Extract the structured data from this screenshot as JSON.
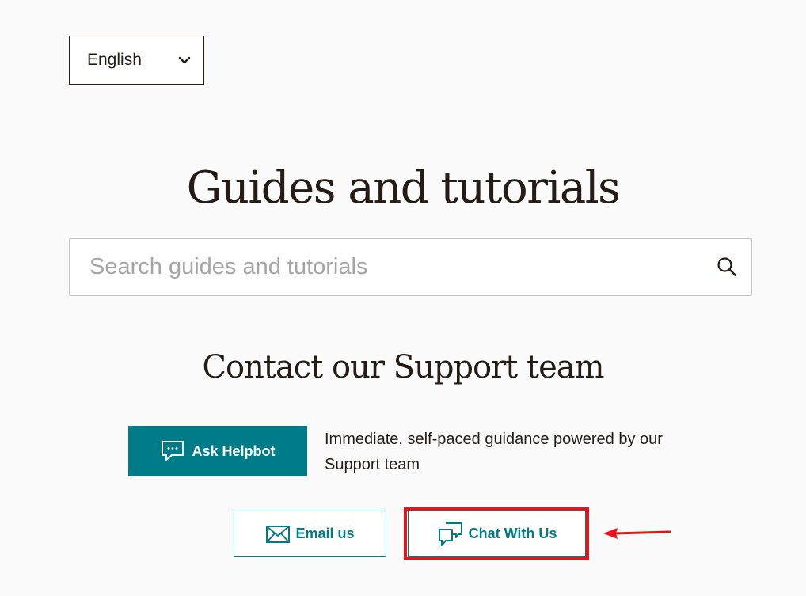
{
  "language_selector": {
    "selected": "English",
    "icon": "chevron-down-icon"
  },
  "hero": {
    "title": "Guides and tutorials"
  },
  "search": {
    "placeholder": "Search guides and tutorials",
    "value": "",
    "icon": "search-icon"
  },
  "contact": {
    "title": "Contact our Support team",
    "helpbot": {
      "label": "Ask Helpbot",
      "icon": "chat-bubble-dots-icon",
      "description": "Immediate, self-paced guidance powered by our Support team"
    },
    "email": {
      "label": "Email us",
      "icon": "envelope-icon"
    },
    "chat": {
      "label": "Chat With Us",
      "icon": "chat-bubbles-icon"
    }
  },
  "colors": {
    "brand": "#007c89",
    "text": "#241c15",
    "background": "#fbfbfb",
    "annotation": "#e8141c"
  }
}
